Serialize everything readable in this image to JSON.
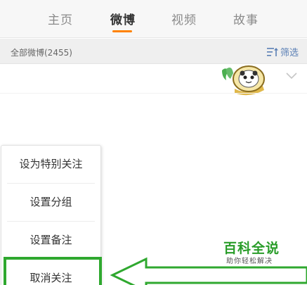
{
  "tabs": [
    {
      "label": "主页",
      "active": false
    },
    {
      "label": "微博",
      "active": true
    },
    {
      "label": "视频",
      "active": false
    },
    {
      "label": "故事",
      "active": false
    }
  ],
  "filter_bar": {
    "title": "全部微博(2455)",
    "filter_label": "筛选",
    "filter_icon": "filter-sort-icon"
  },
  "sticker_icon": "cartoon-sticker-image",
  "menu": {
    "items": [
      {
        "label": "设为特别关注"
      },
      {
        "label": "设置分组"
      },
      {
        "label": "设置备注"
      },
      {
        "label": "取消关注"
      }
    ]
  },
  "watermark": {
    "main": "百科全说",
    "sub": "助你轻松解决"
  },
  "colors": {
    "accent_orange": "#ff8200",
    "highlight_green": "#2fa82f",
    "link_blue": "#5a7fb5"
  }
}
